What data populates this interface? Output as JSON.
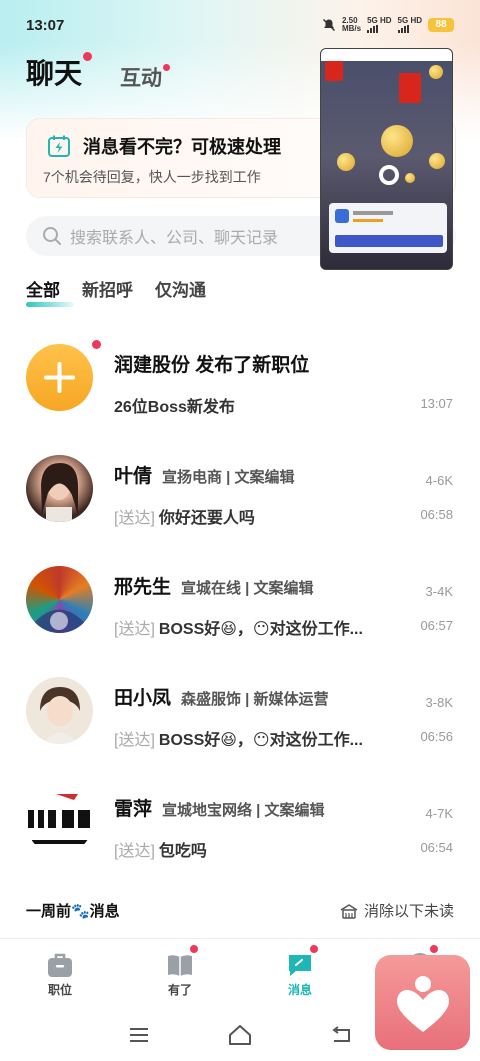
{
  "status_bar": {
    "time": "13:07",
    "net_speed": "2.50",
    "net_unit": "MB/s",
    "sim1": "5G HD",
    "sim2": "5G HD",
    "battery": "88"
  },
  "header": {
    "tab_chat": "聊天",
    "tab_interact": "互动"
  },
  "promo": {
    "title": "消息看不完？可极速处理",
    "subtitle": "7个机会待回复，快人一步找到工作"
  },
  "search": {
    "placeholder": "搜索联系人、公司、聊天记录"
  },
  "filters": [
    "全部",
    "新招呼",
    "仅沟通"
  ],
  "messages": [
    {
      "name": "润建股份 发布了新职位",
      "meta": "",
      "salary": "",
      "tag": "",
      "text": "26位Boss新发布",
      "time": "13:07"
    },
    {
      "name": "叶倩",
      "meta": "宣扬电商 | 文案编辑",
      "salary": "4-6K",
      "tag": "[送达]",
      "text": "你好还要人吗",
      "time": "06:58"
    },
    {
      "name": "邢先生",
      "meta": "宣城在线 | 文案编辑",
      "salary": "3-4K",
      "tag": "[送达]",
      "text": "BOSS好😆，😶对这份工作...",
      "time": "06:57"
    },
    {
      "name": "田小凤",
      "meta": "森盛服饰 | 新媒体运营",
      "salary": "3-8K",
      "tag": "[送达]",
      "text": "BOSS好😆，😶对这份工作...",
      "time": "06:56"
    },
    {
      "name": "雷萍",
      "meta": "宣城地宝网络 | 文案编辑",
      "salary": "4-7K",
      "tag": "[送达]",
      "text": "包吃吗",
      "time": "06:54"
    }
  ],
  "week_bar": {
    "left": "一周前🐾消息",
    "right": "消除以下未读"
  },
  "bottom_nav": [
    "职位",
    "有了",
    "消息",
    ""
  ],
  "colors": {
    "accent": "#20b6b6",
    "badge": "#f0375a",
    "add_circle": "#f9b33b"
  }
}
